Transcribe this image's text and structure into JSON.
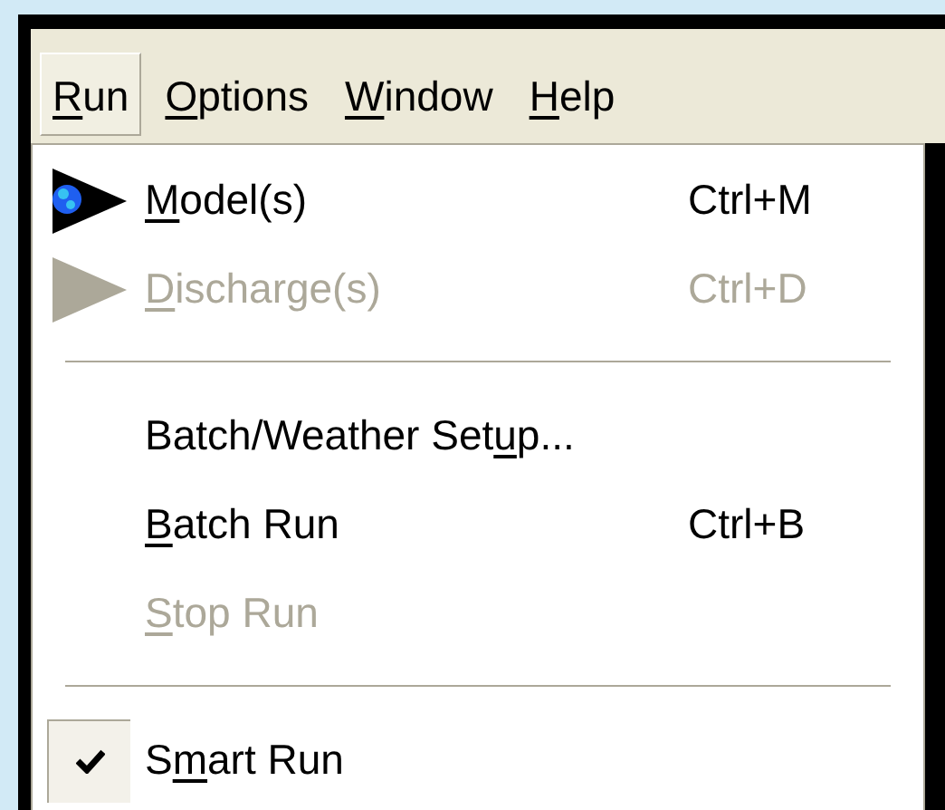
{
  "menu_bar": [
    {
      "label": [
        {
          "text": "R",
          "underlined": true
        },
        {
          "text": "un",
          "underlined": false
        }
      ],
      "selected": true
    },
    {
      "label": [
        {
          "text": "O",
          "underlined": true
        },
        {
          "text": "ptions",
          "underlined": false
        }
      ],
      "selected": false
    },
    {
      "label": [
        {
          "text": "W",
          "underlined": true
        },
        {
          "text": "indow",
          "underlined": false
        }
      ],
      "selected": false
    },
    {
      "label": [
        {
          "text": "H",
          "underlined": true
        },
        {
          "text": "elp",
          "underlined": false
        }
      ],
      "selected": false
    }
  ],
  "menu_items": [
    {
      "kind": "item",
      "label": [
        {
          "text": "M",
          "underlined": true
        },
        {
          "text": "odel(s)",
          "underlined": false
        }
      ],
      "shortcut": "Ctrl+M",
      "disabled": false,
      "checked": false
    },
    {
      "kind": "item",
      "label": [
        {
          "text": "D",
          "underlined": true
        },
        {
          "text": "ischarge(s)",
          "underlined": false
        }
      ],
      "shortcut": "Ctrl+D",
      "disabled": true,
      "checked": false
    },
    {
      "kind": "separator"
    },
    {
      "kind": "item",
      "label": [
        {
          "text": "Batch/Weather Set",
          "underlined": false
        },
        {
          "text": "u",
          "underlined": true
        },
        {
          "text": "p...",
          "underlined": false
        }
      ],
      "disabled": false,
      "checked": false
    },
    {
      "kind": "item",
      "label": [
        {
          "text": "B",
          "underlined": true
        },
        {
          "text": "atch Run",
          "underlined": false
        }
      ],
      "shortcut": "Ctrl+B",
      "disabled": false,
      "checked": false
    },
    {
      "kind": "item",
      "label": [
        {
          "text": "S",
          "underlined": true
        },
        {
          "text": "top Run",
          "underlined": false
        }
      ],
      "disabled": true,
      "checked": false
    },
    {
      "kind": "separator"
    },
    {
      "kind": "item",
      "label": [
        {
          "text": "S",
          "underlined": false
        },
        {
          "text": "m",
          "underlined": true
        },
        {
          "text": "art Run",
          "underlined": false
        }
      ],
      "disabled": false,
      "checked": true
    }
  ]
}
